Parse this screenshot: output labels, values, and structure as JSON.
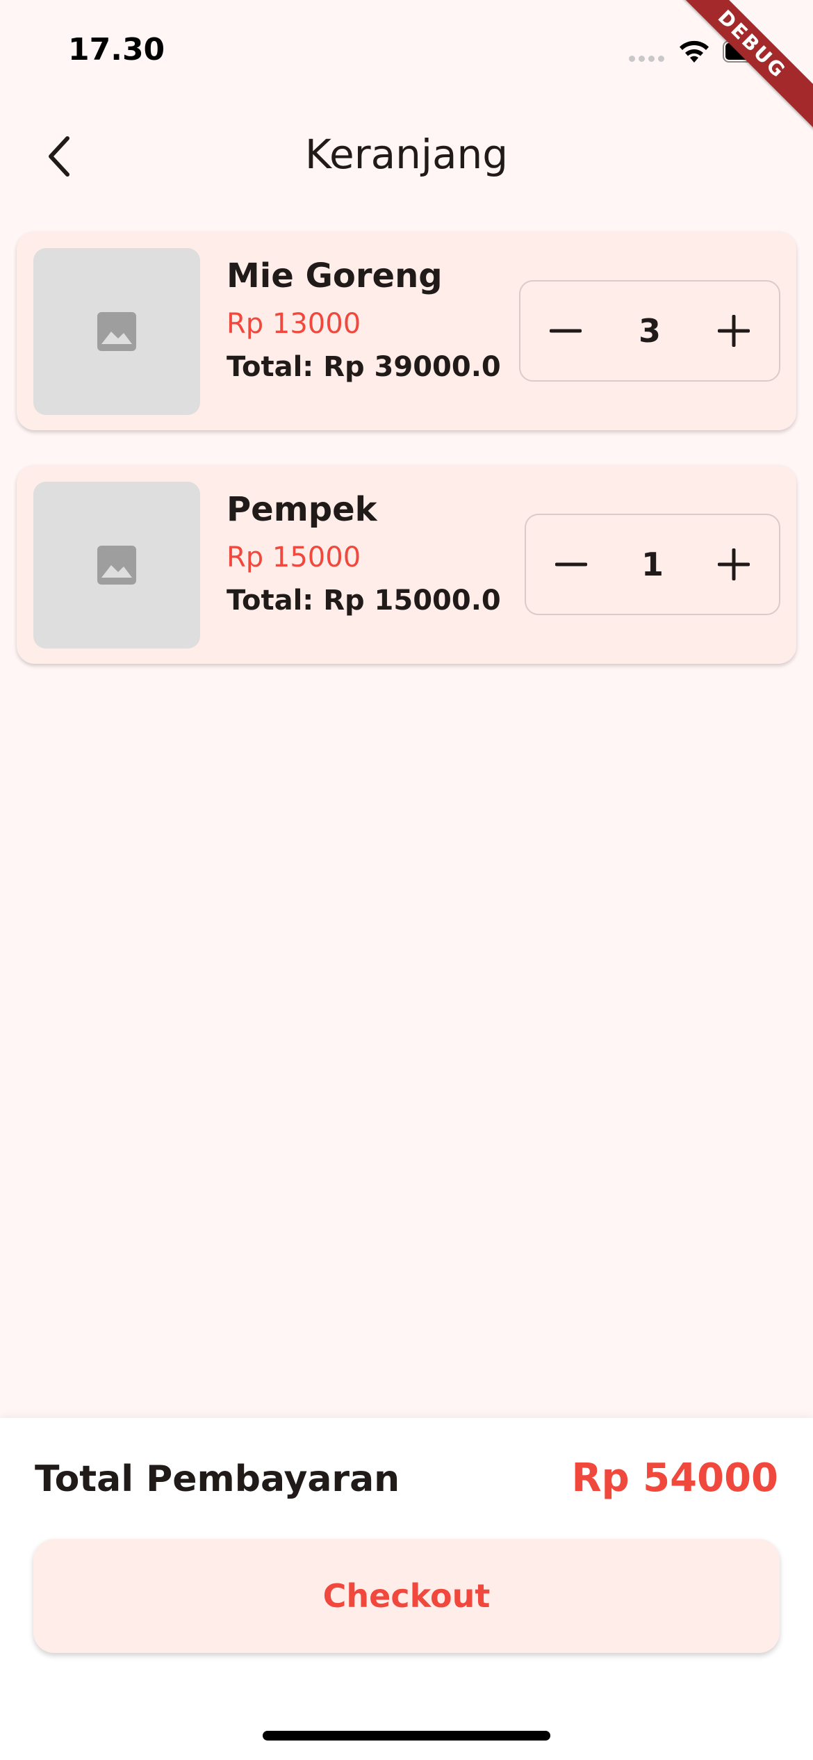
{
  "status_bar": {
    "time": "17.30",
    "icons": [
      "signal-icon",
      "wifi-icon",
      "battery-icon"
    ]
  },
  "debug_banner": "DEBUG",
  "app_bar": {
    "back_icon": "chevron-left-icon",
    "title": "Keranjang"
  },
  "cart": {
    "items": [
      {
        "name": "Mie Goreng",
        "price": "Rp 13000",
        "total": "Total: Rp 39000.0",
        "quantity": "3",
        "image_icon": "image-placeholder-icon"
      },
      {
        "name": "Pempek",
        "price": "Rp 15000",
        "total": "Total: Rp 15000.0",
        "quantity": "1",
        "image_icon": "image-placeholder-icon"
      }
    ]
  },
  "summary": {
    "label": "Total Pembayaran",
    "value": "Rp 54000",
    "checkout_label": "Checkout"
  },
  "colors": {
    "background": "#FFF6F5",
    "card": "#FFEDEA",
    "accent": "#F0483C",
    "text": "#201A19",
    "debug_ribbon": "#A4292A"
  }
}
